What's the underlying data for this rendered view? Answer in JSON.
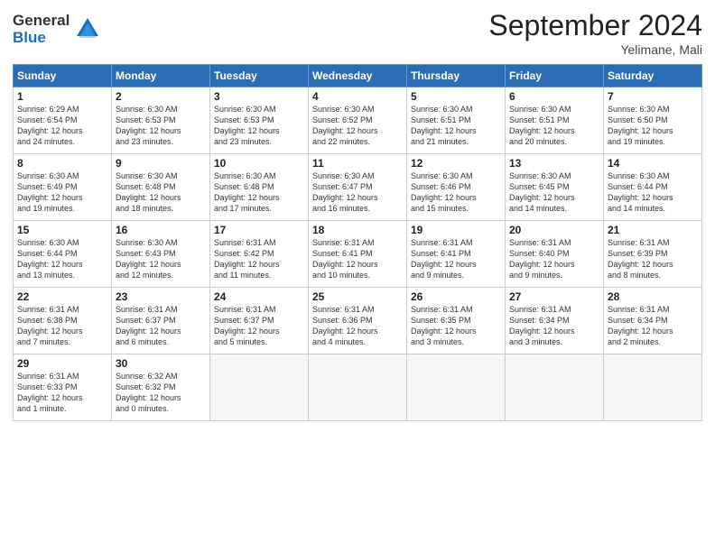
{
  "header": {
    "logo_line1": "General",
    "logo_line2": "Blue",
    "month": "September 2024",
    "location": "Yelimane, Mali"
  },
  "days_of_week": [
    "Sunday",
    "Monday",
    "Tuesday",
    "Wednesday",
    "Thursday",
    "Friday",
    "Saturday"
  ],
  "weeks": [
    [
      {
        "num": "1",
        "info": "Sunrise: 6:29 AM\nSunset: 6:54 PM\nDaylight: 12 hours\nand 24 minutes."
      },
      {
        "num": "2",
        "info": "Sunrise: 6:30 AM\nSunset: 6:53 PM\nDaylight: 12 hours\nand 23 minutes."
      },
      {
        "num": "3",
        "info": "Sunrise: 6:30 AM\nSunset: 6:53 PM\nDaylight: 12 hours\nand 23 minutes."
      },
      {
        "num": "4",
        "info": "Sunrise: 6:30 AM\nSunset: 6:52 PM\nDaylight: 12 hours\nand 22 minutes."
      },
      {
        "num": "5",
        "info": "Sunrise: 6:30 AM\nSunset: 6:51 PM\nDaylight: 12 hours\nand 21 minutes."
      },
      {
        "num": "6",
        "info": "Sunrise: 6:30 AM\nSunset: 6:51 PM\nDaylight: 12 hours\nand 20 minutes."
      },
      {
        "num": "7",
        "info": "Sunrise: 6:30 AM\nSunset: 6:50 PM\nDaylight: 12 hours\nand 19 minutes."
      }
    ],
    [
      {
        "num": "8",
        "info": "Sunrise: 6:30 AM\nSunset: 6:49 PM\nDaylight: 12 hours\nand 19 minutes."
      },
      {
        "num": "9",
        "info": "Sunrise: 6:30 AM\nSunset: 6:48 PM\nDaylight: 12 hours\nand 18 minutes."
      },
      {
        "num": "10",
        "info": "Sunrise: 6:30 AM\nSunset: 6:48 PM\nDaylight: 12 hours\nand 17 minutes."
      },
      {
        "num": "11",
        "info": "Sunrise: 6:30 AM\nSunset: 6:47 PM\nDaylight: 12 hours\nand 16 minutes."
      },
      {
        "num": "12",
        "info": "Sunrise: 6:30 AM\nSunset: 6:46 PM\nDaylight: 12 hours\nand 15 minutes."
      },
      {
        "num": "13",
        "info": "Sunrise: 6:30 AM\nSunset: 6:45 PM\nDaylight: 12 hours\nand 14 minutes."
      },
      {
        "num": "14",
        "info": "Sunrise: 6:30 AM\nSunset: 6:44 PM\nDaylight: 12 hours\nand 14 minutes."
      }
    ],
    [
      {
        "num": "15",
        "info": "Sunrise: 6:30 AM\nSunset: 6:44 PM\nDaylight: 12 hours\nand 13 minutes."
      },
      {
        "num": "16",
        "info": "Sunrise: 6:30 AM\nSunset: 6:43 PM\nDaylight: 12 hours\nand 12 minutes."
      },
      {
        "num": "17",
        "info": "Sunrise: 6:31 AM\nSunset: 6:42 PM\nDaylight: 12 hours\nand 11 minutes."
      },
      {
        "num": "18",
        "info": "Sunrise: 6:31 AM\nSunset: 6:41 PM\nDaylight: 12 hours\nand 10 minutes."
      },
      {
        "num": "19",
        "info": "Sunrise: 6:31 AM\nSunset: 6:41 PM\nDaylight: 12 hours\nand 9 minutes."
      },
      {
        "num": "20",
        "info": "Sunrise: 6:31 AM\nSunset: 6:40 PM\nDaylight: 12 hours\nand 9 minutes."
      },
      {
        "num": "21",
        "info": "Sunrise: 6:31 AM\nSunset: 6:39 PM\nDaylight: 12 hours\nand 8 minutes."
      }
    ],
    [
      {
        "num": "22",
        "info": "Sunrise: 6:31 AM\nSunset: 6:38 PM\nDaylight: 12 hours\nand 7 minutes."
      },
      {
        "num": "23",
        "info": "Sunrise: 6:31 AM\nSunset: 6:37 PM\nDaylight: 12 hours\nand 6 minutes."
      },
      {
        "num": "24",
        "info": "Sunrise: 6:31 AM\nSunset: 6:37 PM\nDaylight: 12 hours\nand 5 minutes."
      },
      {
        "num": "25",
        "info": "Sunrise: 6:31 AM\nSunset: 6:36 PM\nDaylight: 12 hours\nand 4 minutes."
      },
      {
        "num": "26",
        "info": "Sunrise: 6:31 AM\nSunset: 6:35 PM\nDaylight: 12 hours\nand 3 minutes."
      },
      {
        "num": "27",
        "info": "Sunrise: 6:31 AM\nSunset: 6:34 PM\nDaylight: 12 hours\nand 3 minutes."
      },
      {
        "num": "28",
        "info": "Sunrise: 6:31 AM\nSunset: 6:34 PM\nDaylight: 12 hours\nand 2 minutes."
      }
    ],
    [
      {
        "num": "29",
        "info": "Sunrise: 6:31 AM\nSunset: 6:33 PM\nDaylight: 12 hours\nand 1 minute."
      },
      {
        "num": "30",
        "info": "Sunrise: 6:32 AM\nSunset: 6:32 PM\nDaylight: 12 hours\nand 0 minutes."
      },
      {
        "num": "",
        "info": ""
      },
      {
        "num": "",
        "info": ""
      },
      {
        "num": "",
        "info": ""
      },
      {
        "num": "",
        "info": ""
      },
      {
        "num": "",
        "info": ""
      }
    ]
  ]
}
